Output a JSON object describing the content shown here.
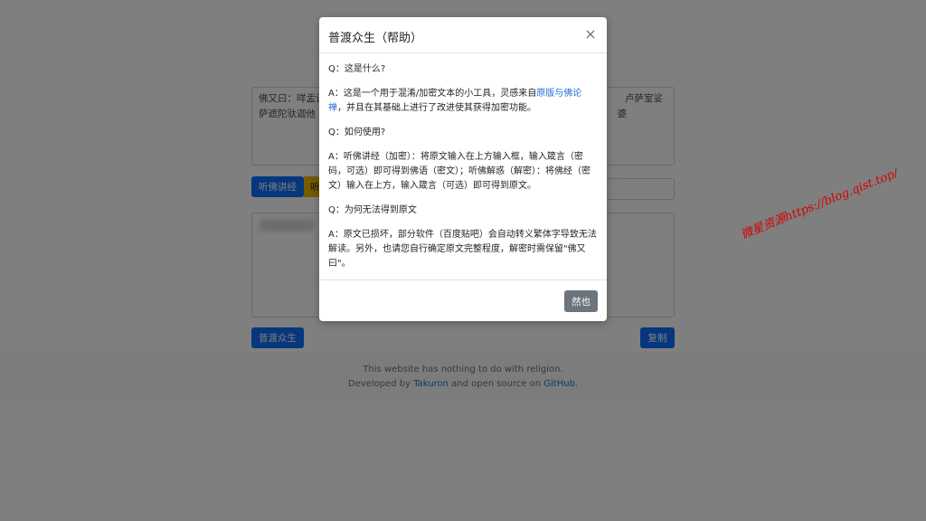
{
  "background": {
    "input_text_line1": "佛又曰：咩盂让",
    "input_text_line2": "萨遮陀驮迦他",
    "input_text_right_line1": "卢萨室娑",
    "input_text_right_line2": "婆",
    "encrypt_button": "听佛讲经",
    "decrypt_button_partial": "听",
    "save_button": "普渡众生",
    "copy_button": "复制",
    "footer_line1": "This website has nothing to do with religion.",
    "footer_line2_prefix": "Developed by ",
    "footer_author": "Takuron",
    "footer_line2_middle": " and open source on ",
    "footer_github": "GitHub",
    "footer_line2_suffix": "."
  },
  "watermark": {
    "text": "微星资源https://blog.qist.top/",
    "color": "#d40000"
  },
  "modal": {
    "title": "普渡众生（帮助）",
    "close_symbol": "×",
    "q1": "Q：这是什么?",
    "a1_prefix": "A：这是一个用于混淆/加密文本的小工具，灵感来自",
    "a1_link": "原版与佛论禅",
    "a1_suffix": "，并且在其基础上进行了改进使其获得加密功能。",
    "q2": "Q：如何使用?",
    "a2": "A：听佛讲经（加密）：将原文输入在上方输入框，输入箴言（密码，可选）即可得到佛语（密文）；听佛解惑（解密）：将佛经（密文）输入在上方，输入箴言（可选）即可得到原文。",
    "q3": "Q：为何无法得到原文",
    "a3": "A：原文已损坏，部分软件（百度贴吧）会自动转义繁体字导致无法解读。另外，也请您自行确定原文完整程度，解密时需保留\"佛又曰\"。",
    "ok_button": "然也"
  },
  "colors": {
    "primary": "#0d6efd",
    "warning": "#f0b400",
    "secondary": "#6c757d",
    "link": "#1a6fd6"
  }
}
